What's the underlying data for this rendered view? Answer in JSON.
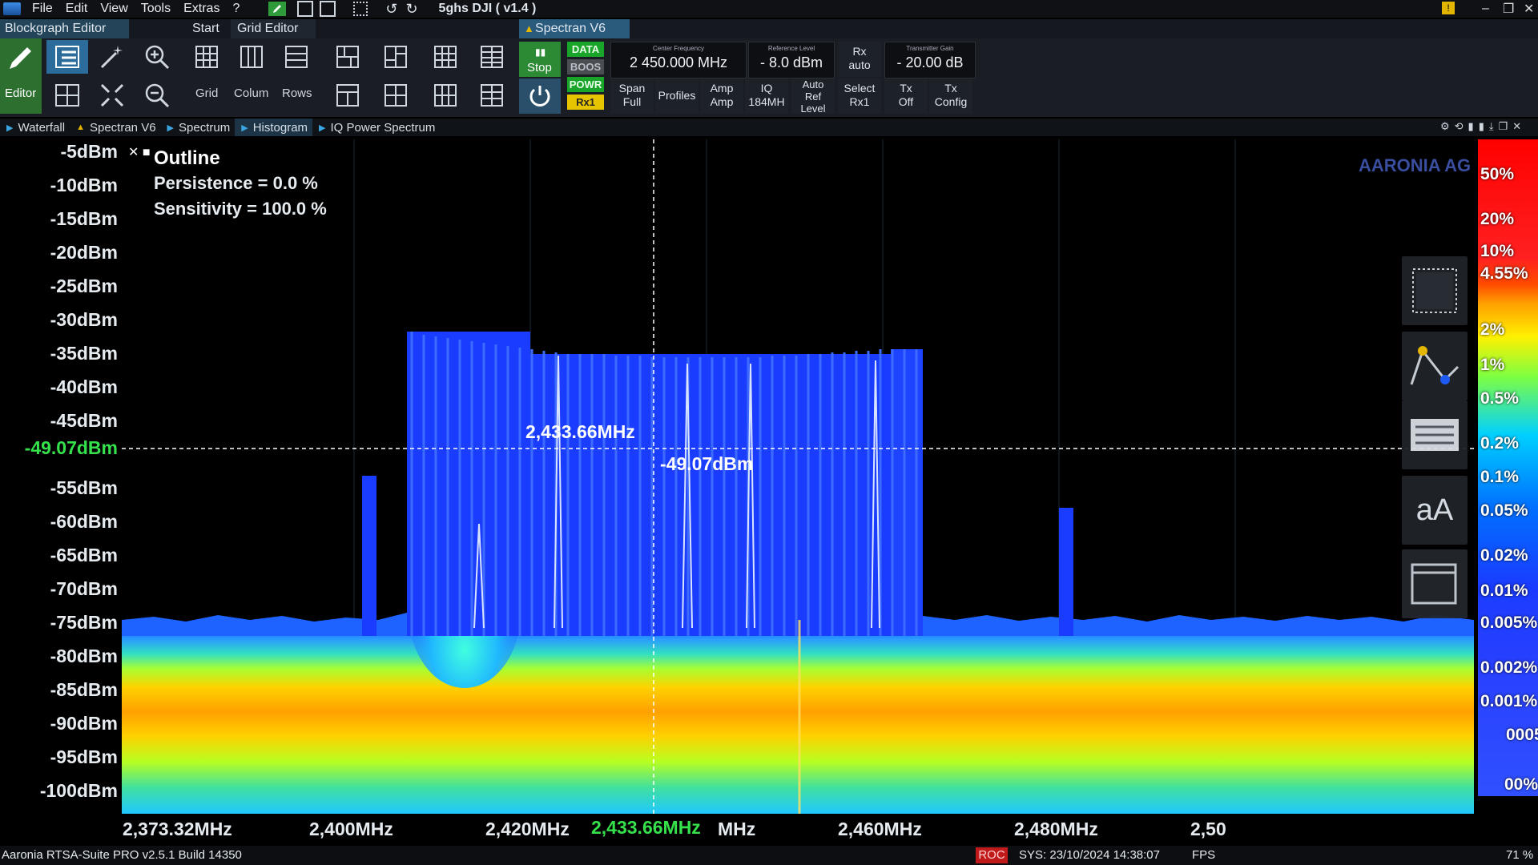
{
  "app": {
    "title": "5ghs DJI ( v1.4 )",
    "menu": [
      "File",
      "Edit",
      "View",
      "Tools",
      "Extras",
      "?"
    ]
  },
  "tabs": {
    "blockgraph": "Blockgraph Editor",
    "start": "Start",
    "grid_editor": "Grid Editor",
    "spectran": "Spectran V6"
  },
  "toolbar": {
    "editor": "Editor",
    "grid": "Grid",
    "columns": "Colum",
    "rows": "Rows",
    "stop": "Stop",
    "flags": [
      "DATA",
      "BOOS",
      "POWR",
      "Rx1"
    ],
    "center_frequency": {
      "caption": "Center Frequency",
      "value": "2 450.000 MHz"
    },
    "reference_level": {
      "caption": "Reference Level",
      "value": "- 8.0 dBm"
    },
    "rx": {
      "line1": "Rx",
      "line2": "auto"
    },
    "transmitter_gain": {
      "caption": "Transmitter Gain",
      "value": "- 20.00 dB"
    },
    "buttons": [
      {
        "line1": "Span",
        "line2": "Full"
      },
      {
        "line1": "Profiles",
        "line2": ""
      },
      {
        "line1": "Amp",
        "line2": "Amp"
      },
      {
        "line1": "IQ",
        "line2": "184MH"
      },
      {
        "line1": "Auto",
        "line2": "Ref Level"
      },
      {
        "line1": "Select",
        "line2": "Rx1"
      },
      {
        "line1": "Tx",
        "line2": "Off"
      },
      {
        "line1": "Tx",
        "line2": "Config"
      }
    ]
  },
  "pane_tabs": [
    "Waterfall",
    "Spectran V6",
    "Spectrum",
    "Histogram",
    "IQ Power Spectrum"
  ],
  "overlay": {
    "title": "Outline",
    "persistence": "Persistence = 0.0 %",
    "sensitivity": "Sensitivity = 100.0 %",
    "marker_freq": "2,433.66MHz",
    "marker_level": "-49.07dBm",
    "watermark": "AARONIA AG",
    "aa_label": "aA"
  },
  "axes": {
    "y_ticks": [
      "-5dBm",
      "-10dBm",
      "-15dBm",
      "-20dBm",
      "-25dBm",
      "-30dBm",
      "-35dBm",
      "-40dBm",
      "-45dBm",
      "-49.07dBm",
      "-55dBm",
      "-60dBm",
      "-65dBm",
      "-70dBm",
      "-75dBm",
      "-80dBm",
      "-85dBm",
      "-90dBm",
      "-95dBm",
      "-100dBm"
    ],
    "x_ticks": [
      "2,373.32MHz",
      "2,400MHz",
      "2,420MHz",
      "2,433.66MHz",
      "MHz",
      "2,460MHz",
      "2,480MHz",
      "2,50"
    ],
    "marker_color": "#36e24c"
  },
  "colorbar": {
    "labels": [
      "50%",
      "20%",
      "10%",
      "4.55%",
      "2%",
      "1%",
      "0.5%",
      "0.2%",
      "0.1%",
      "0.05%",
      "0.02%",
      "0.01%",
      "0.005%",
      "0.002%",
      "0.001%",
      "0005",
      "00%"
    ]
  },
  "status": {
    "left": "Aaronia RTSA-Suite PRO v2.5.1 Build 14350",
    "roc": "ROC",
    "sys": "SYS: 23/10/2024 14:38:07",
    "fps": "FPS",
    "right": "71 %"
  }
}
